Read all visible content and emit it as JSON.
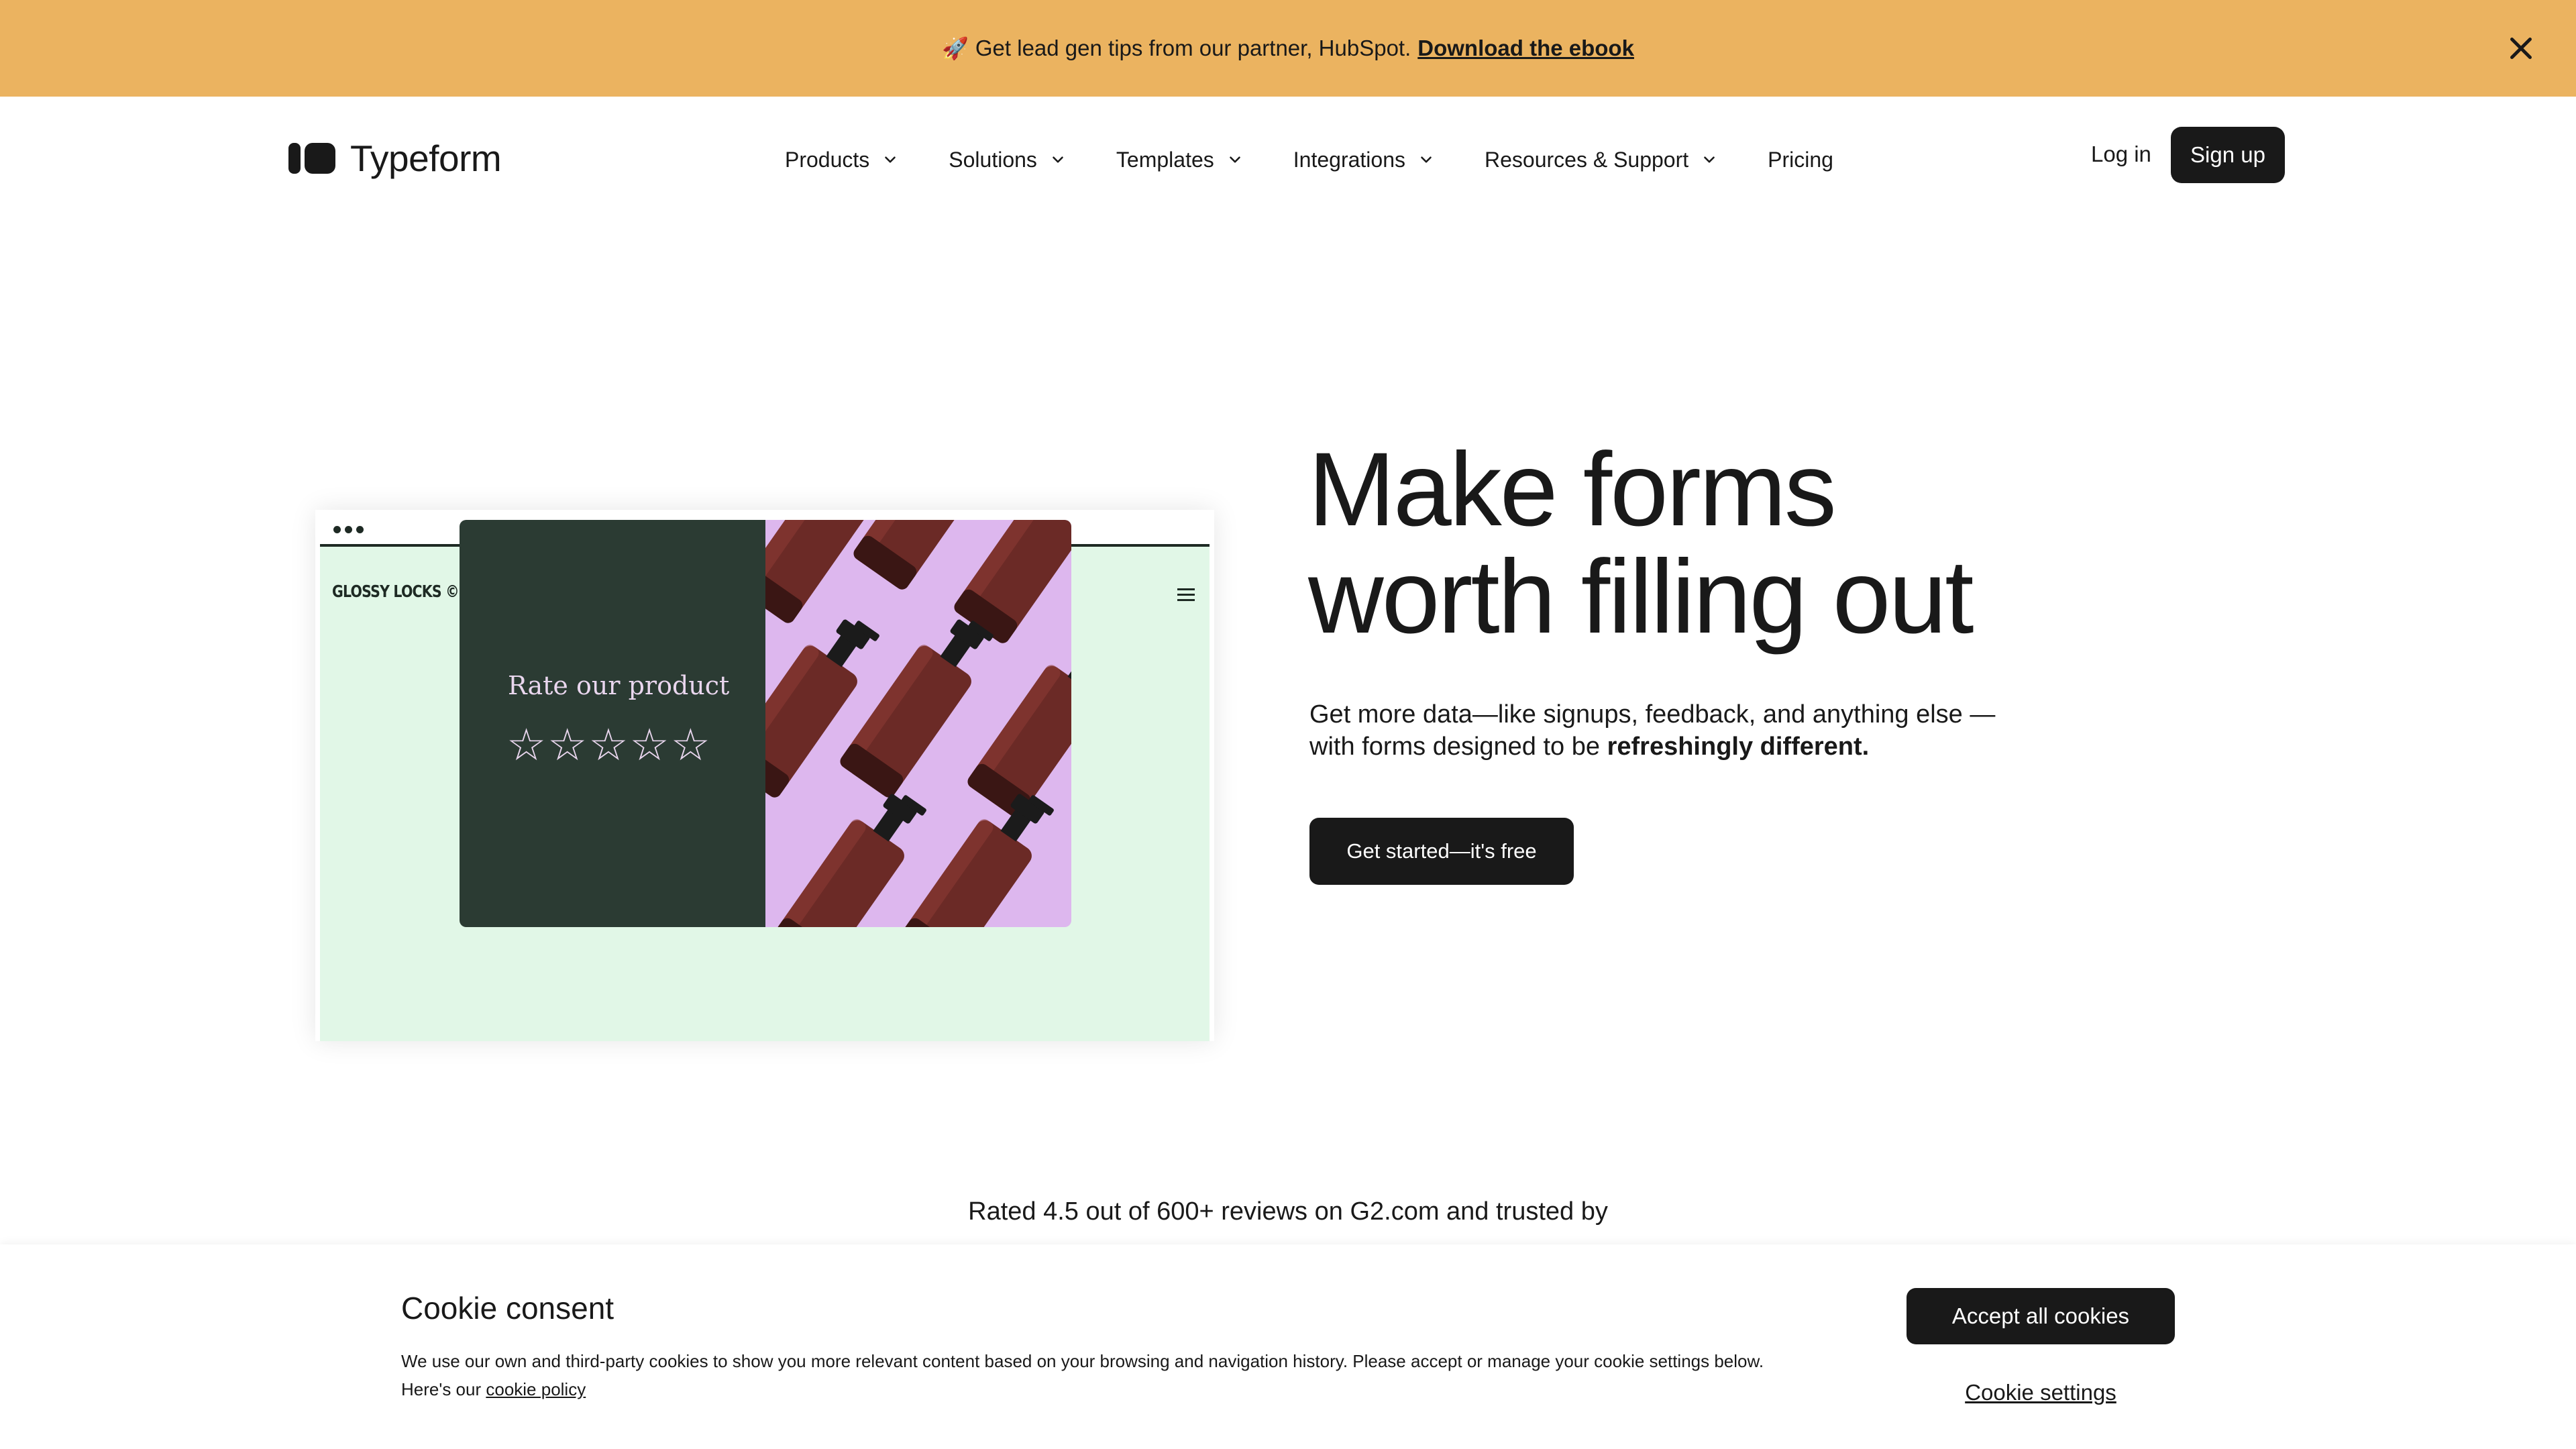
{
  "banner": {
    "text": "Get lead gen tips from our partner, HubSpot.",
    "link": "Download the ebook",
    "icon": "rocket-icon",
    "color": "#ebb360"
  },
  "header": {
    "logo_text": "Typeform",
    "nav": [
      {
        "label": "Products",
        "dropdown": true
      },
      {
        "label": "Solutions",
        "dropdown": true
      },
      {
        "label": "Templates",
        "dropdown": true
      },
      {
        "label": "Integrations",
        "dropdown": true
      },
      {
        "label": "Resources & Support",
        "dropdown": true
      },
      {
        "label": "Pricing",
        "dropdown": false
      }
    ],
    "login": "Log in",
    "signup": "Sign up"
  },
  "illustration": {
    "brand": "GLOSSY LOCKS ©",
    "rate_title": "Rate our product",
    "stars": 5
  },
  "hero": {
    "headline_line1": "Make forms",
    "headline_line2": "worth filling out",
    "sub_prefix": "Get more data—like signups, feedback, and anything else —with forms designed to be",
    "sub_bold": "refreshingly different.",
    "cta": "Get started—it's free"
  },
  "rated_text": "Rated 4.5 out of 600+ reviews on G2.com and trusted by",
  "cookie": {
    "title": "Cookie consent",
    "text": "We use our own and third-party cookies to show you more relevant content based on your browsing and navigation history. Please accept or manage your cookie settings below. Here's our",
    "link": "cookie policy",
    "accept": "Accept all cookies",
    "settings": "Cookie settings"
  }
}
